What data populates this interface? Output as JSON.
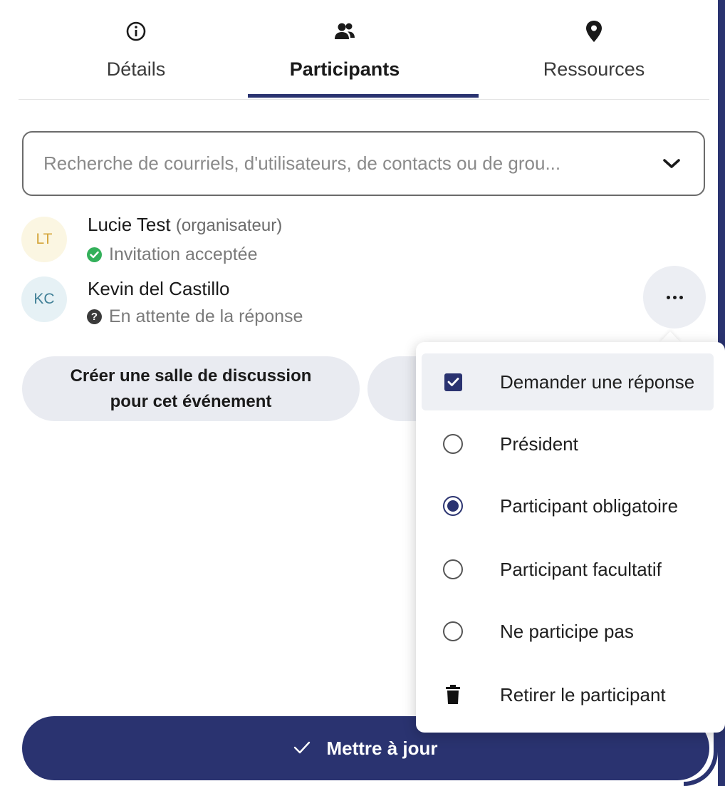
{
  "tabs": [
    {
      "label": "Détails",
      "icon": "info-icon",
      "active": false
    },
    {
      "label": "Participants",
      "icon": "people-icon",
      "active": true
    },
    {
      "label": "Ressources",
      "icon": "location-pin-icon",
      "active": false
    }
  ],
  "search": {
    "placeholder": "Recherche de courriels, d'utilisateurs, de contacts ou de grou..."
  },
  "attendees": [
    {
      "initials": "LT",
      "name": "Lucie Test",
      "role": "(organisateur)",
      "status": "Invitation acceptée"
    },
    {
      "initials": "KC",
      "name": "Kevin del Castillo",
      "role": "",
      "status": "En attente de la réponse"
    }
  ],
  "chat_button": {
    "line1": "Créer une salle de discussion",
    "line2": "pour cet événement"
  },
  "menu": {
    "items": [
      {
        "label": "Demander une réponse",
        "control": "checkbox",
        "checked": true
      },
      {
        "label": "Président",
        "control": "radio",
        "checked": false
      },
      {
        "label": "Participant obligatoire",
        "control": "radio",
        "checked": true
      },
      {
        "label": "Participant facultatif",
        "control": "radio",
        "checked": false
      },
      {
        "label": "Ne participe pas",
        "control": "radio",
        "checked": false
      },
      {
        "label": "Retirer le participant",
        "control": "trash",
        "checked": false
      }
    ]
  },
  "update_button": {
    "label": "Mettre à jour"
  },
  "colors": {
    "accent": "#2a3370",
    "accepted": "#33b05a"
  }
}
